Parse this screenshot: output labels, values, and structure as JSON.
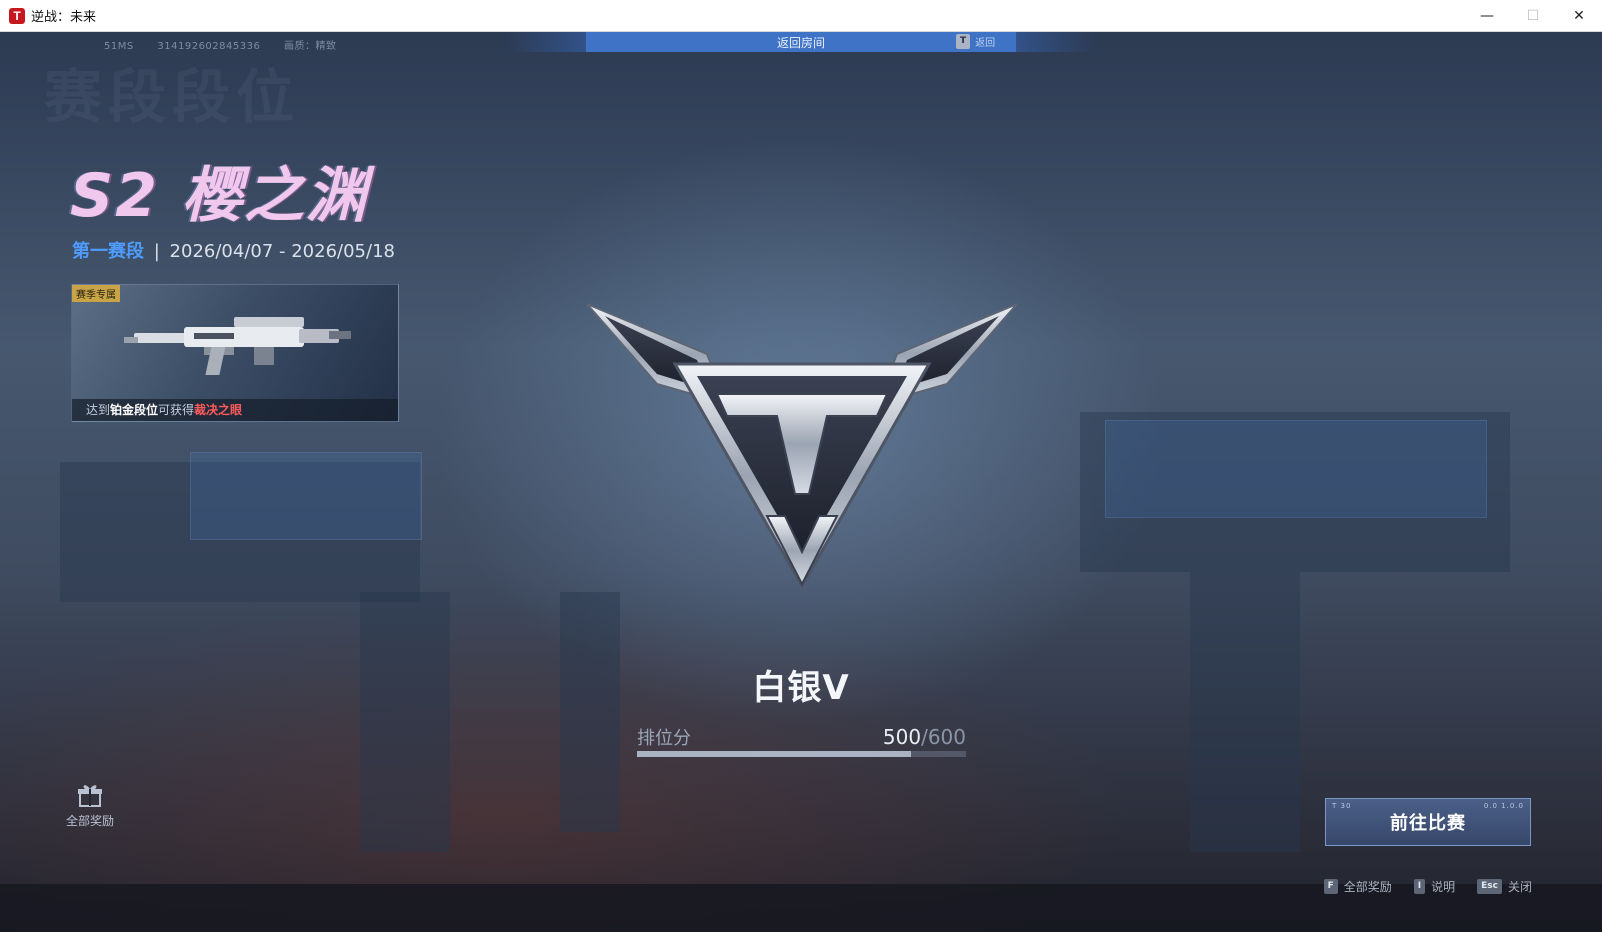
{
  "window": {
    "title": "逆战：未来",
    "icon_glyph": "T",
    "minimize": "—",
    "maximize": "☐",
    "close": "✕"
  },
  "top_info": {
    "server": "51MS",
    "session_id": "314192602845336",
    "quality": "画质：精致"
  },
  "return_bar": {
    "label": "返回房间",
    "key": "T",
    "key_label": "返回"
  },
  "season": {
    "background_heading": "赛段段位",
    "title": "S2 樱之渊",
    "stage": "第一赛段",
    "separator": "|",
    "dates": "2026/04/07 - 2026/05/18"
  },
  "reward_card": {
    "tag": "赛季专属",
    "caption_pre": "达到",
    "caption_rank": "铂金段位",
    "caption_mid": "可获得",
    "caption_item": "裁决之眼"
  },
  "rank": {
    "name": "白银V",
    "score_label": "排位分",
    "score": "500",
    "score_max": "/600",
    "progress": 0.8333
  },
  "all_rewards_label": "全部奖励",
  "go_match": {
    "label": "前往比赛",
    "corner_left": "T 30",
    "corner_right": "0.0 1.0.0"
  },
  "hints": [
    {
      "key": "F",
      "label": "全部奖励"
    },
    {
      "key": "I",
      "label": "说明"
    },
    {
      "key": "Esc",
      "label": "关闭"
    }
  ],
  "colors": {
    "accent_blue": "#3f73c6",
    "stage_blue": "#4f9cff",
    "highlight_red": "#ff5a5a",
    "title_pink": "#f0c8ee"
  }
}
